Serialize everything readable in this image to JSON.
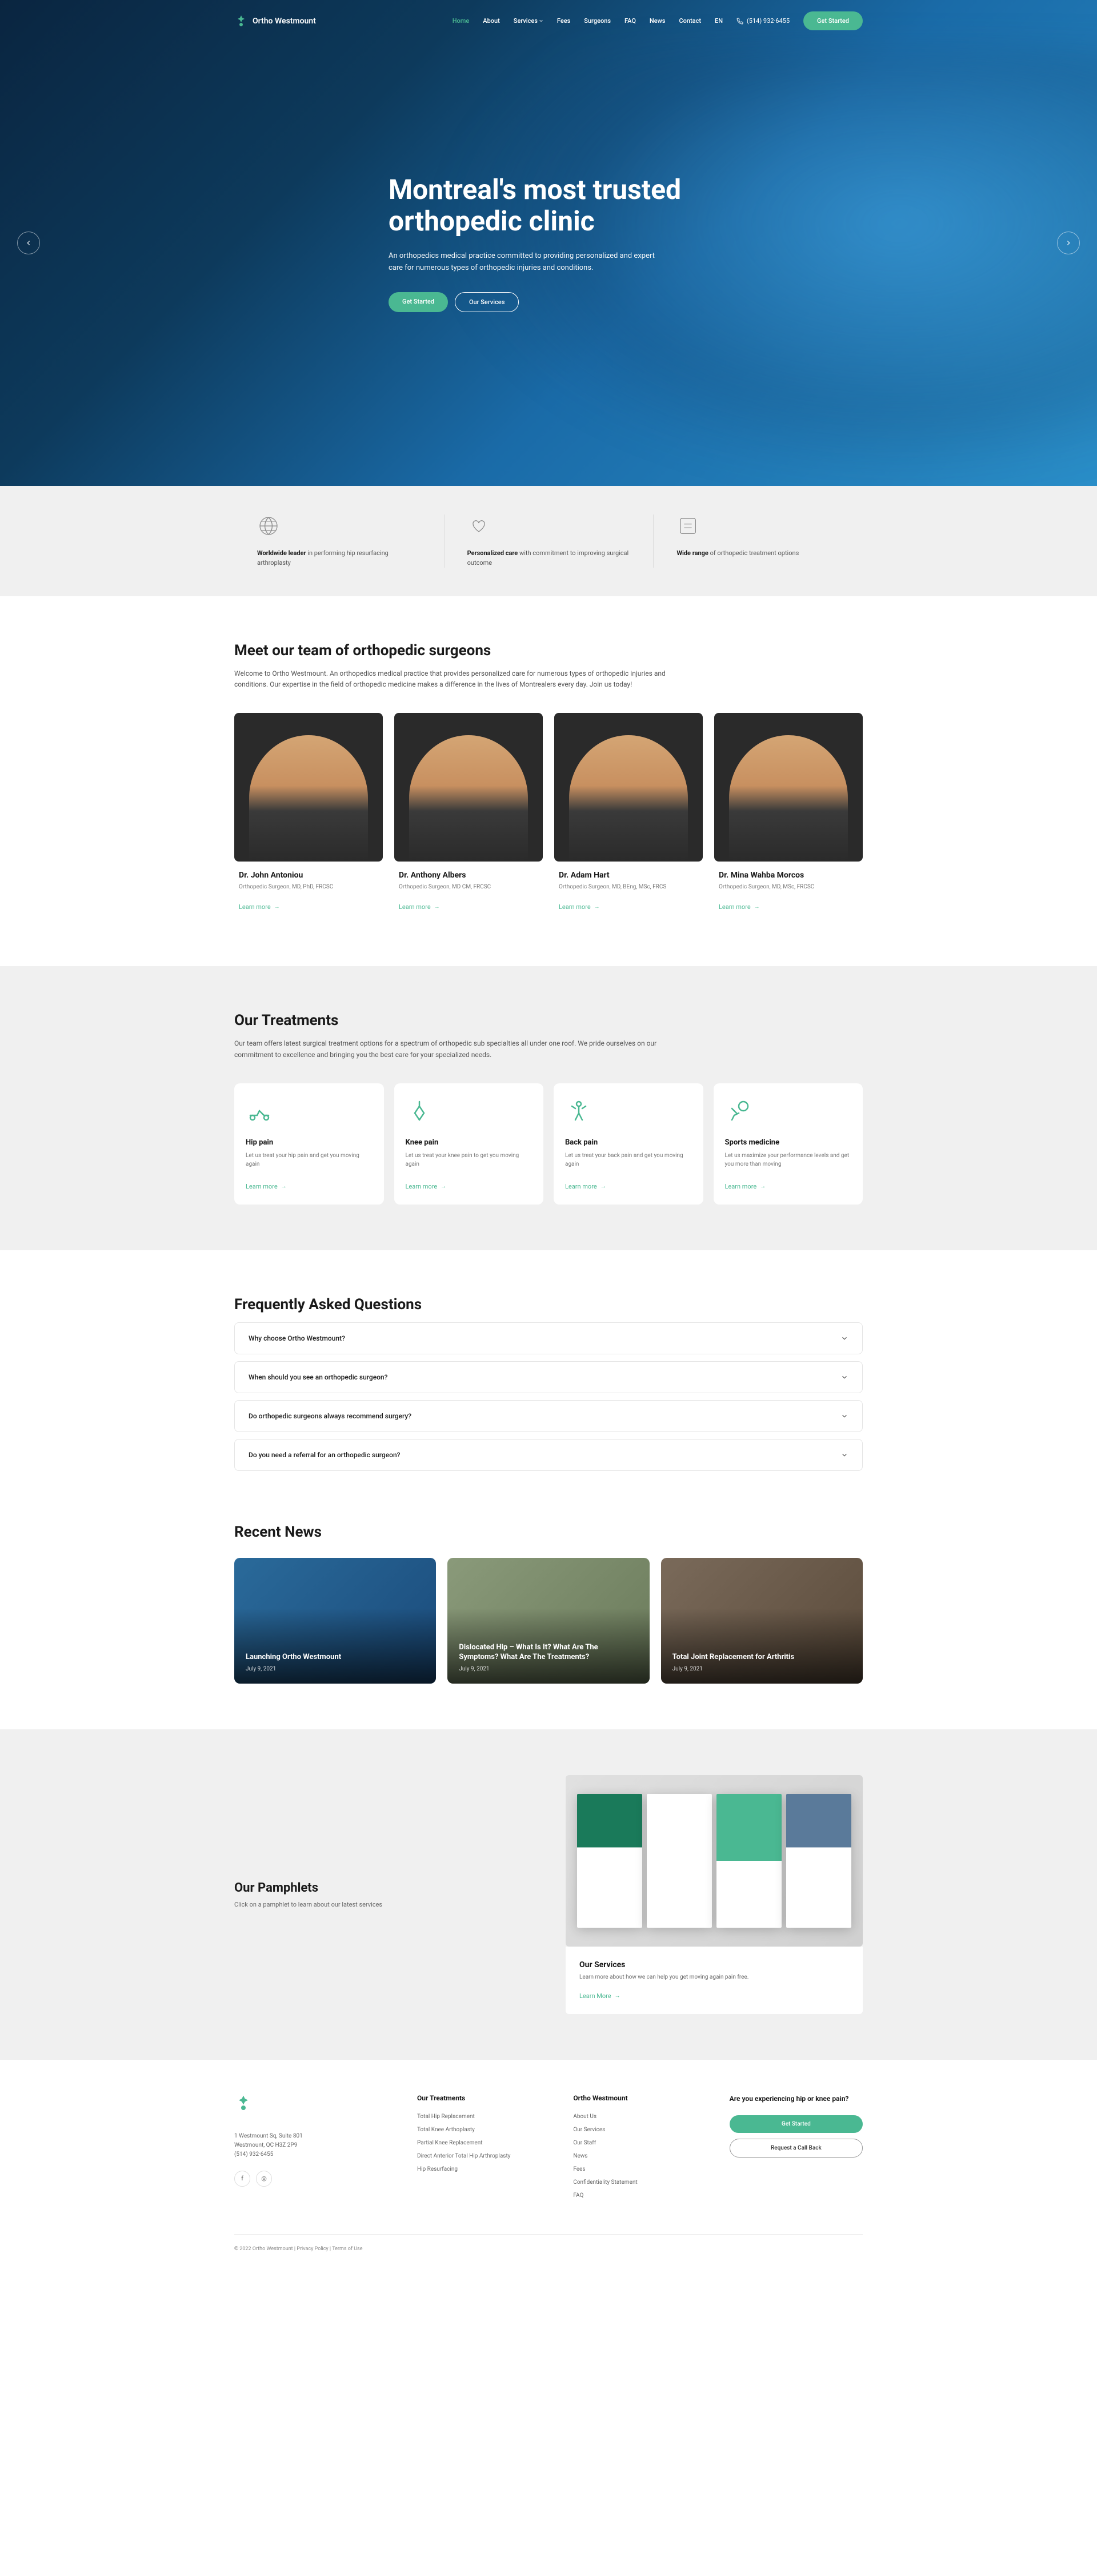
{
  "brand": "Ortho Westmount",
  "nav": {
    "home": "Home",
    "about": "About",
    "services": "Services",
    "fees": "Fees",
    "surgeons": "Surgeons",
    "faq": "FAQ",
    "news": "News",
    "contact": "Contact",
    "lang": "EN",
    "phone": "(514) 932·6455",
    "cta": "Get Started"
  },
  "hero": {
    "title": "Montreal's most trusted orthopedic clinic",
    "subtitle": "An orthopedics medical practice committed to providing personalized and expert care for numerous types of orthopedic injuries and conditions.",
    "btn1": "Get Started",
    "btn2": "Our Services"
  },
  "features": [
    {
      "strong": "Worldwide leader",
      "text": " in performing hip resurfacing arthroplasty"
    },
    {
      "strong": "Personalized care",
      "text": " with commitment to improving surgical outcome"
    },
    {
      "strong": "Wide range",
      "text": " of orthopedic treatment options"
    }
  ],
  "team": {
    "heading": "Meet our team of orthopedic surgeons",
    "intro": "Welcome to Ortho Westmount. An orthopedics medical practice that provides personalized care for numerous types of orthopedic injuries and conditions. Our expertise in the field of orthopedic medicine makes a difference in the lives of Montrealers every day. Join us today!",
    "learn_more": "Learn more",
    "surgeons": [
      {
        "name": "Dr. John Antoniou",
        "title": "Orthopedic Surgeon, MD, PhD, FRCSC"
      },
      {
        "name": "Dr. Anthony Albers",
        "title": "Orthopedic Surgeon, MD CM, FRCSC"
      },
      {
        "name": "Dr. Adam Hart",
        "title": "Orthopedic Surgeon, MD, BEng, MSc, FRCS"
      },
      {
        "name": "Dr. Mina Wahba Morcos",
        "title": "Orthopedic Surgeon, MD, MSc, FRCSC"
      }
    ]
  },
  "treatments": {
    "heading": "Our Treatments",
    "intro": "Our team offers latest surgical treatment options for a spectrum of orthopedic sub specialties all under one roof. We pride ourselves on our commitment to excellence and bringing you the best care for your specialized needs.",
    "learn_more": "Learn more",
    "items": [
      {
        "name": "Hip pain",
        "desc": "Let us treat your hip pain and get you moving again"
      },
      {
        "name": "Knee pain",
        "desc": "Let us treat your knee pain to get you moving again"
      },
      {
        "name": "Back pain",
        "desc": "Let us treat your back pain and get you moving again"
      },
      {
        "name": "Sports medicine",
        "desc": "Let us maximize your performance levels and get you more than moving"
      }
    ]
  },
  "faq": {
    "heading": "Frequently Asked Questions",
    "items": [
      "Why choose Ortho Westmount?",
      "When should you see an orthopedic surgeon?",
      "Do orthopedic surgeons always recommend surgery?",
      "Do you need a referral for an orthopedic surgeon?"
    ]
  },
  "news": {
    "heading": "Recent News",
    "items": [
      {
        "title": "Launching Ortho Westmount",
        "date": "July 9, 2021"
      },
      {
        "title": "Dislocated Hip – What Is It? What Are The Symptoms? What Are The Treatments?",
        "date": "July 9, 2021"
      },
      {
        "title": "Total Joint Replacement for Arthritis",
        "date": "July 9, 2021"
      }
    ]
  },
  "pamphlets": {
    "heading": "Our Pamphlets",
    "subtitle": "Click on a pamphlet to learn about our latest services",
    "card_title": "Our Services",
    "card_text": "Learn more about how we can help you get moving again pain free.",
    "learn_more": "Learn More"
  },
  "footer": {
    "address_line1": "1 Westmount Sq, Suite 801",
    "address_line2": "Westmount, QC  H3Z 2P9",
    "address_line3": "(514) 932·6455",
    "col1_heading": "Our Treatments",
    "col1": [
      "Total Hip Replacement",
      "Total Knee Arthoplasty",
      "Partial Knee Replacement",
      "Direct Anterior Total Hip Arthroplasty",
      "Hip Resurfacing"
    ],
    "col2_heading": "Ortho Westmount",
    "col2": [
      "About Us",
      "Our Services",
      "Our Staff",
      "News",
      "Fees",
      "Confidentiality Statement",
      "FAQ"
    ],
    "cta_heading": "Are you experiencing hip or knee pain?",
    "cta_btn1": "Get Started",
    "cta_btn2": "Request a Call Back",
    "copyright": "© 2022 Ortho Westmount",
    "privacy": "Privacy Policy",
    "terms": "Terms of Use"
  }
}
